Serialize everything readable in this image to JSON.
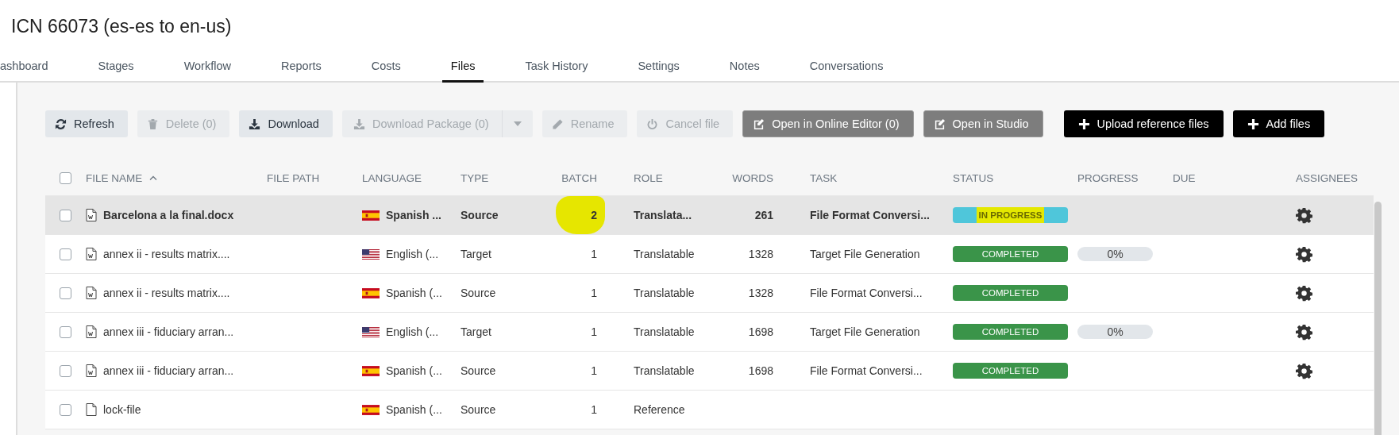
{
  "title": "ICN 66073 (es-es to en-us)",
  "tabs": [
    {
      "label": "ashboard",
      "selected": false
    },
    {
      "label": "Stages",
      "selected": false
    },
    {
      "label": "Workflow",
      "selected": false
    },
    {
      "label": "Reports",
      "selected": false
    },
    {
      "label": "Costs",
      "selected": false
    },
    {
      "label": "Files",
      "selected": true
    },
    {
      "label": "Task History",
      "selected": false
    },
    {
      "label": "Settings",
      "selected": false
    },
    {
      "label": "Notes",
      "selected": false
    },
    {
      "label": "Conversations",
      "selected": false
    }
  ],
  "toolbar": [
    {
      "label": "Refresh",
      "kind": "light",
      "disabled": false
    },
    {
      "label": "Delete (0)",
      "kind": "light",
      "disabled": true
    },
    {
      "label": "Download",
      "kind": "light",
      "disabled": false
    },
    {
      "label": "Download Package (0)",
      "kind": "split",
      "disabled": true
    },
    {
      "label": "Rename",
      "kind": "light",
      "disabled": true
    },
    {
      "label": "Cancel file",
      "kind": "light",
      "disabled": true
    },
    {
      "label": "Open in Online Editor (0)",
      "kind": "dark"
    },
    {
      "label": "Open in Studio",
      "kind": "dark"
    },
    {
      "label": "Upload reference files",
      "kind": "black"
    },
    {
      "label": "Add files",
      "kind": "black"
    }
  ],
  "table": {
    "select_all_checked": false,
    "columns": [
      {
        "label": "FILE NAME",
        "sorted": true
      },
      {
        "label": "FILE PATH",
        "sorted": false
      },
      {
        "label": "LANGUAGE",
        "sorted": false
      },
      {
        "label": "TYPE",
        "sorted": false
      },
      {
        "label": "BATCH",
        "sorted": false
      },
      {
        "label": "ROLE",
        "sorted": false
      },
      {
        "label": "WORDS",
        "sorted": false
      },
      {
        "label": "TASK",
        "sorted": false
      },
      {
        "label": "STATUS",
        "sorted": false
      },
      {
        "label": "PROGRESS",
        "sorted": false
      },
      {
        "label": "DUE",
        "sorted": false
      },
      {
        "label": "ASSIGNEES",
        "sorted": false
      }
    ],
    "rows": [
      {
        "selected": true,
        "checked": false,
        "file": {
          "name": "Barcelona a la final.docx",
          "kind": "word"
        },
        "language": {
          "text": "Spanish ...",
          "kind": "spanish"
        },
        "type": "Source",
        "batch": "2",
        "batch_highlighted": true,
        "role": "Translata...",
        "words": "261",
        "task": "File Format Conversi...",
        "status": {
          "label": "IN PROGRESS",
          "kind": "in_progress",
          "highlighted": true
        },
        "has_assignee_gear": true
      },
      {
        "selected": false,
        "checked": false,
        "file": {
          "name": "annex ii - results matrix....",
          "kind": "word"
        },
        "language": {
          "text": "English (...",
          "kind": "english"
        },
        "type": "Target",
        "batch": "1",
        "batch_highlighted": false,
        "role": "Translatable",
        "words": "1328",
        "task": "Target File Generation",
        "status": {
          "label": "COMPLETED",
          "kind": "completed",
          "highlighted": false
        },
        "progress": {
          "level": 0,
          "text": "0%"
        },
        "has_assignee_gear": true
      },
      {
        "selected": false,
        "checked": false,
        "file": {
          "name": "annex ii - results matrix....",
          "kind": "word"
        },
        "language": {
          "text": "Spanish (...",
          "kind": "spanish"
        },
        "type": "Source",
        "batch": "1",
        "batch_highlighted": false,
        "role": "Translatable",
        "words": "1328",
        "task": "File Format Conversi...",
        "status": {
          "label": "COMPLETED",
          "kind": "completed",
          "highlighted": false
        },
        "has_assignee_gear": true
      },
      {
        "selected": false,
        "checked": false,
        "file": {
          "name": "annex iii - fiduciary arran...",
          "kind": "word"
        },
        "language": {
          "text": "English (...",
          "kind": "english"
        },
        "type": "Target",
        "batch": "1",
        "batch_highlighted": false,
        "role": "Translatable",
        "words": "1698",
        "task": "Target File Generation",
        "status": {
          "label": "COMPLETED",
          "kind": "completed",
          "highlighted": false
        },
        "progress": {
          "level": 0,
          "text": "0%"
        },
        "has_assignee_gear": true
      },
      {
        "selected": false,
        "checked": false,
        "file": {
          "name": "annex iii - fiduciary arran...",
          "kind": "word"
        },
        "language": {
          "text": "Spanish (...",
          "kind": "spanish"
        },
        "type": "Source",
        "batch": "1",
        "batch_highlighted": false,
        "role": "Translatable",
        "words": "1698",
        "task": "File Format Conversi...",
        "status": {
          "label": "COMPLETED",
          "kind": "completed",
          "highlighted": false
        },
        "has_assignee_gear": true
      },
      {
        "selected": false,
        "checked": false,
        "file": {
          "name": "lock-file",
          "kind": "plain"
        },
        "language": {
          "text": "Spanish (...",
          "kind": "spanish"
        },
        "type": "Source",
        "batch": "1",
        "batch_highlighted": false,
        "role": "Reference",
        "has_assignee_gear": false
      }
    ]
  }
}
